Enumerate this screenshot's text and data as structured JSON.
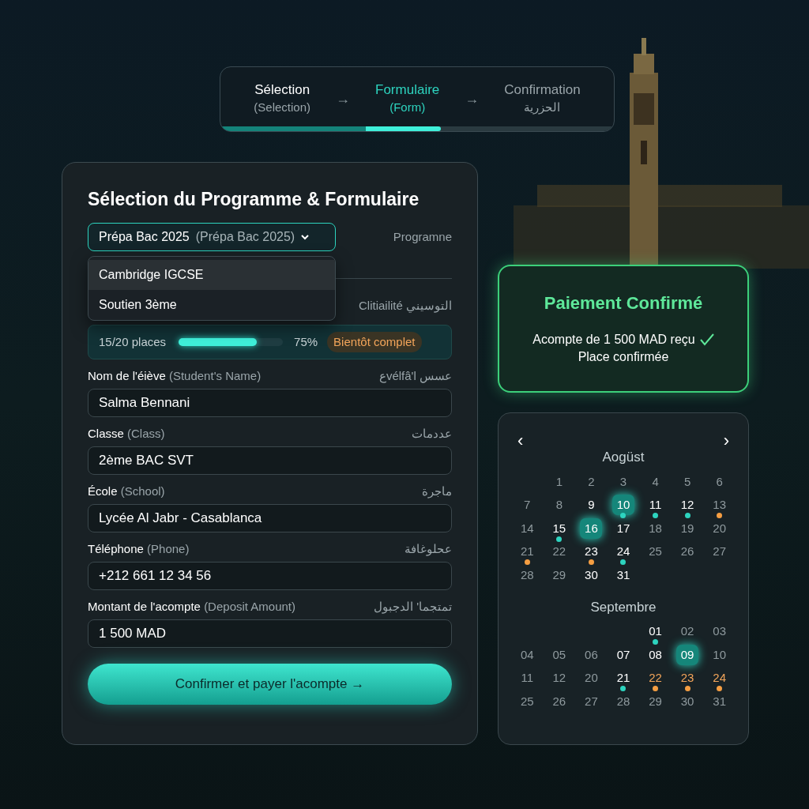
{
  "stepper": {
    "steps": [
      {
        "label": "Sélection",
        "sublabel": "(Selection)",
        "selected": false
      },
      {
        "label": "Formulaire",
        "sublabel": "(Form)",
        "selected": true
      },
      {
        "label": "Confirmation",
        "sublabel": "الحزرية",
        "selected": false
      }
    ],
    "separators": [
      "→",
      "→"
    ],
    "level": 0.56
  },
  "form": {
    "title": "Sélection du Programme & Formulaire",
    "program_select": {
      "value": "Prépa Bac 2025",
      "value_note": "(Prépa Bac 2025)",
      "side_label": "Programne",
      "expanded": true,
      "options": [
        {
          "label": "Cambridge IGCSE",
          "selected": true
        },
        {
          "label": "Soutien 3ème",
          "selected": false
        }
      ]
    },
    "hidden_row_label": "Clitiailité التوسيني",
    "availability": {
      "places": "15/20 places",
      "level": 0.75,
      "percent": "75%",
      "badge": "Bientôt complet"
    },
    "fields": [
      {
        "label": "Nom de l'éiève",
        "sublabel": "(Student's Name)",
        "arabic": "عvélfâ'l عسس",
        "value": "Salma Bennani"
      },
      {
        "label": "Classe",
        "sublabel": "(Class)",
        "arabic": "عددمات",
        "value": "2ème BAC SVT"
      },
      {
        "label": "École",
        "sublabel": "(School)",
        "arabic": "ماجرة",
        "value": "Lycée Al Jabr - Casablanca"
      },
      {
        "label": "Téléphone",
        "sublabel": "(Phone)",
        "arabic": "عحلوغافة",
        "value": "+212 661 12 34 56"
      },
      {
        "label": "Montant de l'acompte",
        "sublabel": "(Deposit Amount)",
        "arabic": "تمتجما' الدجبول",
        "value": "1 500 MAD"
      }
    ],
    "submit": "Confirmer et payer l'acompte →"
  },
  "payment": {
    "title": "Paiement Confirmé",
    "line1": "Acompte de 1 500 MAD reçu",
    "line2": "Place confirmée"
  },
  "calendar": {
    "prev": "‹",
    "next": "›",
    "months": [
      {
        "name": "Aogüst",
        "days": [
          {
            "kind": "blank"
          },
          {
            "kind": "day",
            "label": "1",
            "muted": true,
            "selected": false
          },
          {
            "kind": "day",
            "label": "2",
            "muted": true,
            "selected": false
          },
          {
            "kind": "day",
            "label": "3",
            "muted": true,
            "selected": false
          },
          {
            "kind": "day",
            "label": "4",
            "muted": true,
            "selected": false
          },
          {
            "kind": "day",
            "label": "5",
            "muted": true,
            "selected": false
          },
          {
            "kind": "day",
            "label": "6",
            "muted": true,
            "selected": false
          },
          {
            "kind": "day",
            "label": "7",
            "muted": true,
            "selected": false
          },
          {
            "kind": "day",
            "label": "8",
            "muted": true,
            "selected": false
          },
          {
            "kind": "day",
            "label": "9",
            "muted": false,
            "selected": false
          },
          {
            "kind": "day",
            "label": "10",
            "muted": false,
            "selected": true,
            "color": "#2dd4bf"
          },
          {
            "kind": "day",
            "label": "11",
            "muted": false,
            "selected": false,
            "color": "#2dd4bf"
          },
          {
            "kind": "day",
            "label": "12",
            "muted": false,
            "selected": false,
            "color": "#2dd4bf"
          },
          {
            "kind": "day",
            "label": "13",
            "muted": true,
            "selected": false,
            "color": "#f59e42"
          },
          {
            "kind": "day",
            "label": "14",
            "muted": true,
            "selected": false
          },
          {
            "kind": "day",
            "label": "15",
            "muted": false,
            "selected": false,
            "color": "#2dd4bf"
          },
          {
            "kind": "day",
            "label": "16",
            "muted": false,
            "selected": true
          },
          {
            "kind": "day",
            "label": "17",
            "muted": false,
            "selected": false
          },
          {
            "kind": "day",
            "label": "18",
            "muted": true,
            "selected": false
          },
          {
            "kind": "day",
            "label": "19",
            "muted": true,
            "selected": false
          },
          {
            "kind": "day",
            "label": "20",
            "muted": true,
            "selected": false
          },
          {
            "kind": "day",
            "label": "21",
            "muted": true,
            "selected": false,
            "color": "#f59e42"
          },
          {
            "kind": "day",
            "label": "22",
            "muted": true,
            "selected": false
          },
          {
            "kind": "day",
            "label": "23",
            "muted": false,
            "selected": false,
            "color": "#f59e42"
          },
          {
            "kind": "day",
            "label": "24",
            "muted": false,
            "selected": false,
            "color": "#2dd4bf"
          },
          {
            "kind": "day",
            "label": "25",
            "muted": true,
            "selected": false
          },
          {
            "kind": "day",
            "label": "26",
            "muted": true,
            "selected": false
          },
          {
            "kind": "day",
            "label": "27",
            "muted": true,
            "selected": false
          },
          {
            "kind": "day",
            "label": "28",
            "muted": true,
            "selected": false
          },
          {
            "kind": "day",
            "label": "29",
            "muted": true,
            "selected": false
          },
          {
            "kind": "day",
            "label": "30",
            "muted": false,
            "selected": false
          },
          {
            "kind": "day",
            "label": "31",
            "muted": false,
            "selected": false
          }
        ]
      },
      {
        "name": "Septembre",
        "days": [
          {
            "kind": "blank"
          },
          {
            "kind": "blank"
          },
          {
            "kind": "blank"
          },
          {
            "kind": "blank"
          },
          {
            "kind": "day",
            "label": "01",
            "muted": false,
            "selected": false,
            "color": "#2dd4bf"
          },
          {
            "kind": "day",
            "label": "02",
            "muted": true,
            "selected": false
          },
          {
            "kind": "day",
            "label": "03",
            "muted": true,
            "selected": false
          },
          {
            "kind": "day",
            "label": "04",
            "muted": true,
            "selected": false
          },
          {
            "kind": "day",
            "label": "05",
            "muted": true,
            "selected": false
          },
          {
            "kind": "day",
            "label": "06",
            "muted": true,
            "selected": false
          },
          {
            "kind": "day",
            "label": "07",
            "muted": false,
            "selected": false
          },
          {
            "kind": "day",
            "label": "08",
            "muted": false,
            "selected": false
          },
          {
            "kind": "day",
            "label": "09",
            "muted": false,
            "selected": true
          },
          {
            "kind": "day",
            "label": "10",
            "muted": true,
            "selected": false
          },
          {
            "kind": "day",
            "label": "11",
            "muted": true,
            "selected": false
          },
          {
            "kind": "day",
            "label": "12",
            "muted": true,
            "selected": false
          },
          {
            "kind": "day",
            "label": "20",
            "muted": true,
            "selected": false
          },
          {
            "kind": "day",
            "label": "21",
            "muted": false,
            "selected": false,
            "color": "#2dd4bf"
          },
          {
            "kind": "day",
            "label": "22",
            "muted": false,
            "selected": false,
            "color": "#f59e42",
            "accent_text": true
          },
          {
            "kind": "day",
            "label": "23",
            "muted": false,
            "selected": false,
            "color": "#f59e42",
            "accent_text": true
          },
          {
            "kind": "day",
            "label": "24",
            "muted": false,
            "selected": false,
            "color": "#f59e42",
            "accent_text": true
          },
          {
            "kind": "day",
            "label": "25",
            "muted": true,
            "selected": false
          },
          {
            "kind": "day",
            "label": "26",
            "muted": true,
            "selected": false
          },
          {
            "kind": "day",
            "label": "27",
            "muted": true,
            "selected": false
          },
          {
            "kind": "day",
            "label": "28",
            "muted": true,
            "selected": false
          },
          {
            "kind": "day",
            "label": "29",
            "muted": true,
            "selected": false
          },
          {
            "kind": "day",
            "label": "30",
            "muted": true,
            "selected": false
          },
          {
            "kind": "day",
            "label": "31",
            "muted": true,
            "selected": false
          }
        ]
      }
    ]
  }
}
